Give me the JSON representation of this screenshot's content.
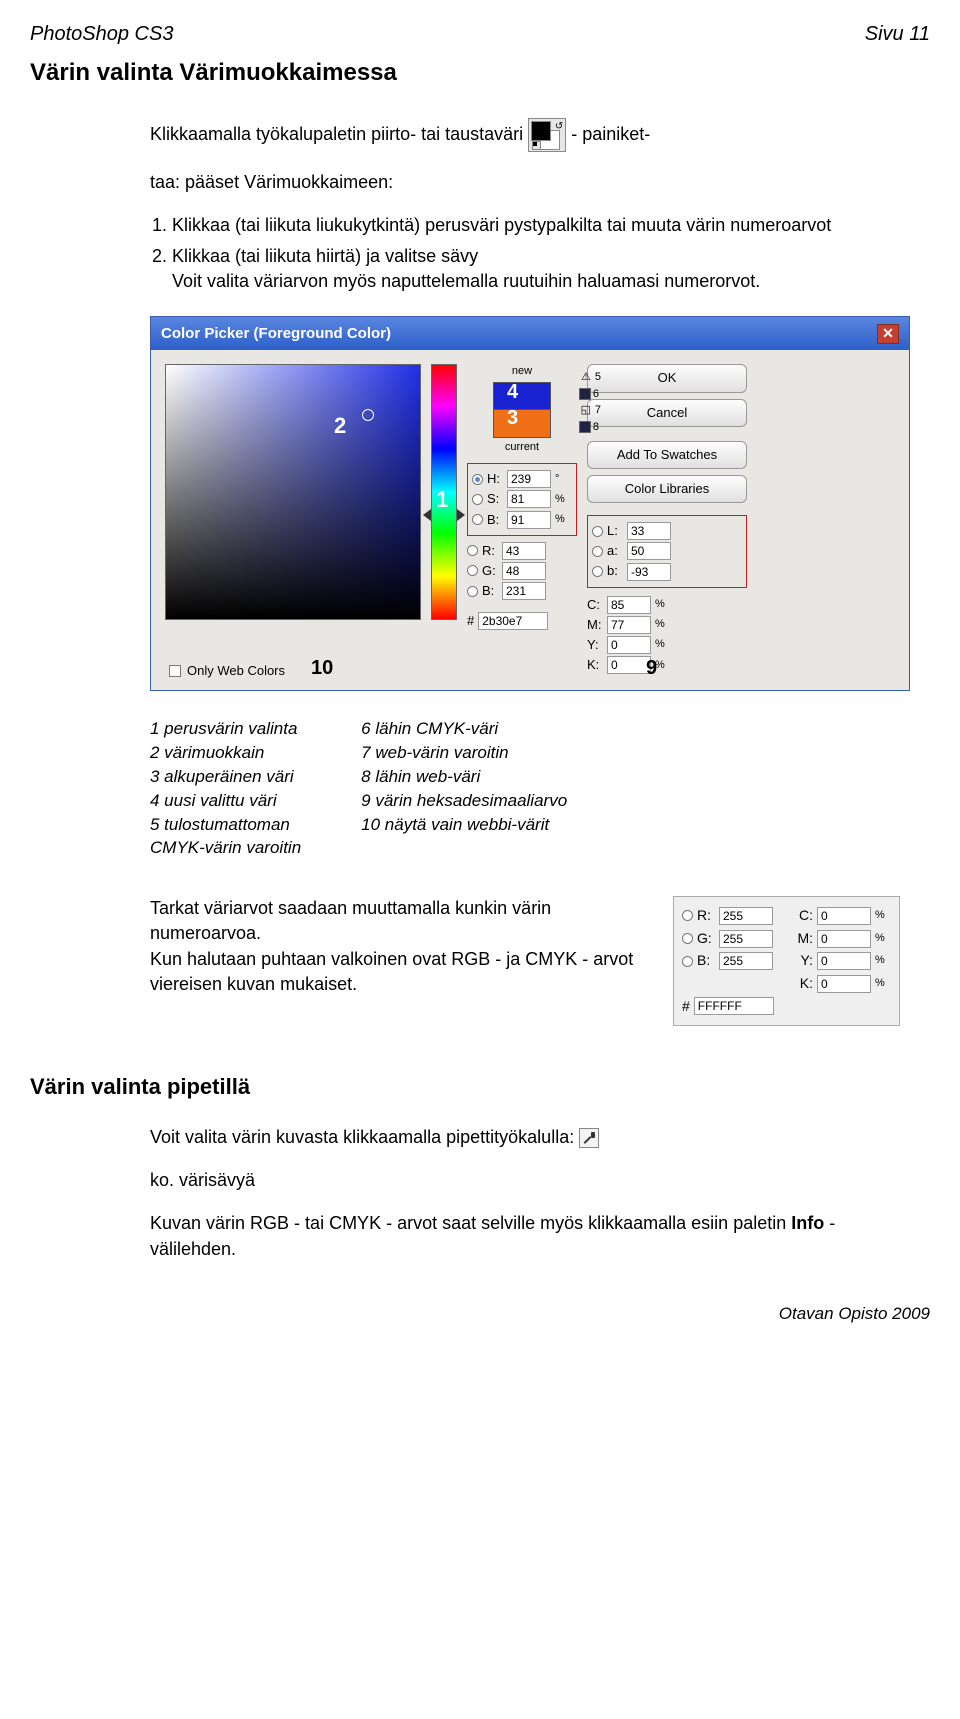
{
  "header": {
    "left": "PhotoShop CS3",
    "right": "Sivu 11"
  },
  "title": "Värin valinta Värimuokkaimessa",
  "intro1_a": "Klikkaamalla työkalupaletin piirto- tai taustaväri",
  "intro1_b": "- painiket-",
  "intro2": "taa: pääset Värimuokkaimeen:",
  "steps": [
    "Klikkaa (tai liikuta liukukytkintä) perusväri pystypalkilta tai muuta värin numeroarvot",
    "Klikkaa (tai liikuta hiirtä) ja valitse sävy\nVoit valita väriarvon myös naputtelemalla ruutuihin haluamasi numerorvot."
  ],
  "picker": {
    "title": "Color Picker (Foreground Color)",
    "new_label": "new",
    "current_label": "current",
    "buttons": {
      "ok": "OK",
      "cancel": "Cancel",
      "add": "Add To Swatches",
      "lib": "Color Libraries"
    },
    "only_web": "Only Web Colors",
    "hsb": {
      "H": "239",
      "Hunit": "°",
      "S": "81",
      "B": "91"
    },
    "lab": {
      "L": "33",
      "a": "50",
      "b": "-93"
    },
    "rgb": {
      "R": "43",
      "G": "48",
      "B": "231"
    },
    "cmyk": {
      "C": "85",
      "M": "77",
      "Y": "0",
      "K": "0"
    },
    "hex_label": "#",
    "hex": "2b30e7",
    "annot": {
      "n1": "1",
      "n2": "2",
      "n3": "3",
      "n4": "4",
      "n5": "5",
      "n6": "6",
      "n7": "7",
      "n8": "8",
      "n9": "9",
      "n10": "10"
    }
  },
  "legend_left": "1   perusvärin valinta\n2   värimuokkain\n3   alkuperäinen väri\n4   uusi valittu väri\n5   tulostumattoman\n     CMYK-värin varoitin",
  "legend_right": "6   lähin CMYK-väri\n7   web-värin varoitin\n8   lähin web-väri\n9   värin heksadesimaaliarvo\n10 näytä vain webbi-värit",
  "para2": "Tarkat väriarvot saadaan muuttamalla kunkin värin numeroarvoa.\nKun halutaan puhtaan valkoinen ovat RGB - ja CMYK - arvot viereisen kuvan mukaiset.",
  "mini": {
    "R": "255",
    "G": "255",
    "B": "255",
    "C": "0",
    "M": "0",
    "Y": "0",
    "K": "0",
    "hex_label": "#",
    "hex": "FFFFFF"
  },
  "h2": "Värin valinta pipetillä",
  "pip1": "Voit valita värin kuvasta klikkaamalla pipettityökalulla:",
  "pip2": "ko. värisävyä",
  "pip3": "Kuvan värin RGB - tai CMYK - arvot saat selville myös klikkaamalla esiin paletin Info - välilehden.",
  "info_word": "Info",
  "footer": "Otavan Opisto 2009"
}
